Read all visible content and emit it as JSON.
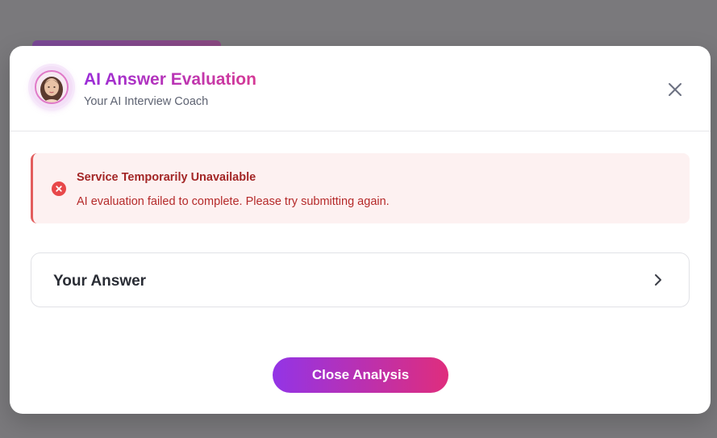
{
  "header": {
    "title": "AI Answer Evaluation",
    "subtitle": "Your AI Interview Coach",
    "avatar_icon": "coach-avatar-icon",
    "close_icon": "close-icon"
  },
  "alert": {
    "title": "Service Temporarily Unavailable",
    "message": "AI evaluation failed to complete. Please try submitting again.",
    "icon": "error-circle-icon",
    "color": "#e35d5d"
  },
  "answer_section": {
    "label": "Your Answer",
    "icon": "chevron-right-icon"
  },
  "footer": {
    "close_label": "Close Analysis"
  },
  "colors": {
    "accent_start": "#9334e6",
    "accent_end": "#df2d7d",
    "error_bg": "#fdf1f1"
  }
}
